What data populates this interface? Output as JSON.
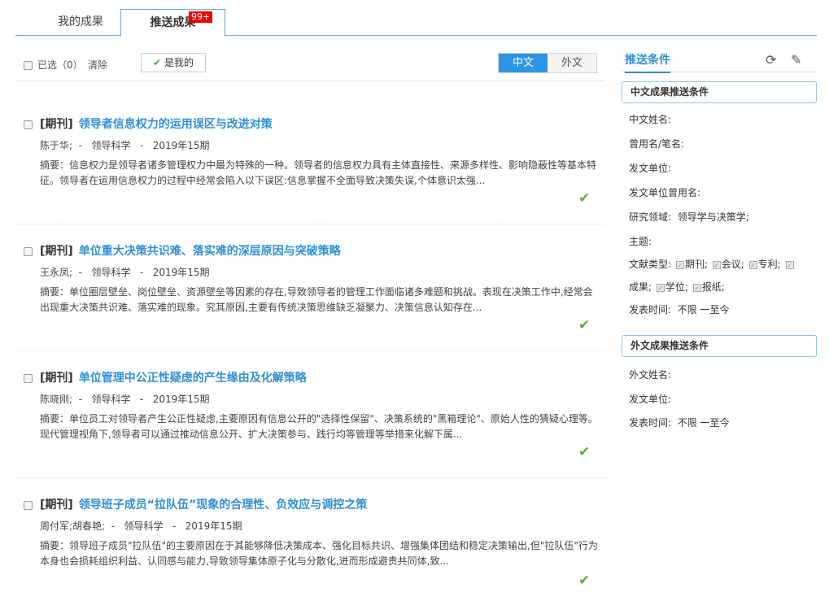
{
  "tabs": [
    {
      "label": "我的成果"
    },
    {
      "label": "推送成果",
      "badge": "99+"
    }
  ],
  "toolbar": {
    "select_all": "已选（0）",
    "clear": "清除",
    "mine_button": "是我的",
    "lang_cn": "中文",
    "lang_foreign": "外文"
  },
  "results": [
    {
      "type": "[期刊]",
      "title": "领导者信息权力的运用误区与改进对策",
      "authors": "陈于华;",
      "journal": "领导科学",
      "issue": "2019年15期",
      "abstract": "摘要：信息权力是领导者诸多管理权力中最为特殊的一种。领导者的信息权力具有主体直接性、来源多样性、影响隐蔽性等基本特征。领导者在运用信息权力的过程中经常会陷入以下误区:信息掌握不全面导致决策失误,个体意识太强..."
    },
    {
      "type": "[期刊]",
      "title": "单位重大决策共识难、落实难的深层原因与突破策略",
      "authors": "王永凤;",
      "journal": "领导科学",
      "issue": "2019年15期",
      "abstract": "摘要：单位圈层壁垒、岗位壁垒、资源壁垒等因素的存在,导致领导者的管理工作面临诸多难题和挑战。表现在决策工作中,经常会出现重大决策共识难、落实难的现象。究其原因,主要有传统决策思维缺乏凝聚力、决策信息认知存在..."
    },
    {
      "type": "[期刊]",
      "title": "单位管理中公正性疑虑的产生缘由及化解策略",
      "authors": "陈晓刚;",
      "journal": "领导科学",
      "issue": "2019年15期",
      "abstract": "摘要：单位员工对领导者产生公正性疑虑,主要原因有信息公开的\"选择性保留\"、决策系统的\"黑箱理论\"、原始人性的猜疑心理等。现代管理视角下,领导者可以通过推动信息公开、扩大决策参与、践行均等管理等举措来化解下属..."
    },
    {
      "type": "[期刊]",
      "title": "领导班子成员“拉队伍”现象的合理性、负效应与调控之策",
      "authors": "周付军;胡春艳;",
      "journal": "领导科学",
      "issue": "2019年15期",
      "abstract": "摘要：领导班子成员\"拉队伍\"的主要原因在于其能够降低决策成本、强化目标共识、增强集体团结和稳定决策输出,但\"拉队伍\"行为本身也会损耗组织利益、认同感与能力,导致领导集体原子化与分散化,进而形成避责共同体,致..."
    }
  ],
  "right_panel": {
    "title": "推送条件",
    "cn_section": "中文成果推送条件",
    "cn_fields": {
      "name": "中文姓名:",
      "alias": "曾用名/笔名:",
      "unit": "发文单位:",
      "unit_alias": "发文单位曾用名:",
      "field_label": "研究领域:",
      "field_value": "领导学与决策学;",
      "topic": "主题:",
      "doc_type_label": "文献类型:",
      "doc_type_line1": [
        "期刊;",
        "会议;",
        "专利;"
      ],
      "doc_type_line2": [
        "成果;",
        "学位;",
        "报纸;"
      ],
      "time_label": "发表时间:",
      "time_value": "不限 一至今"
    },
    "foreign_section": "外文成果推送条件",
    "foreign_fields": {
      "name": "外文姓名:",
      "unit": "发文单位:",
      "time_label": "发表时间:",
      "time_value": "不限 一至今"
    }
  }
}
